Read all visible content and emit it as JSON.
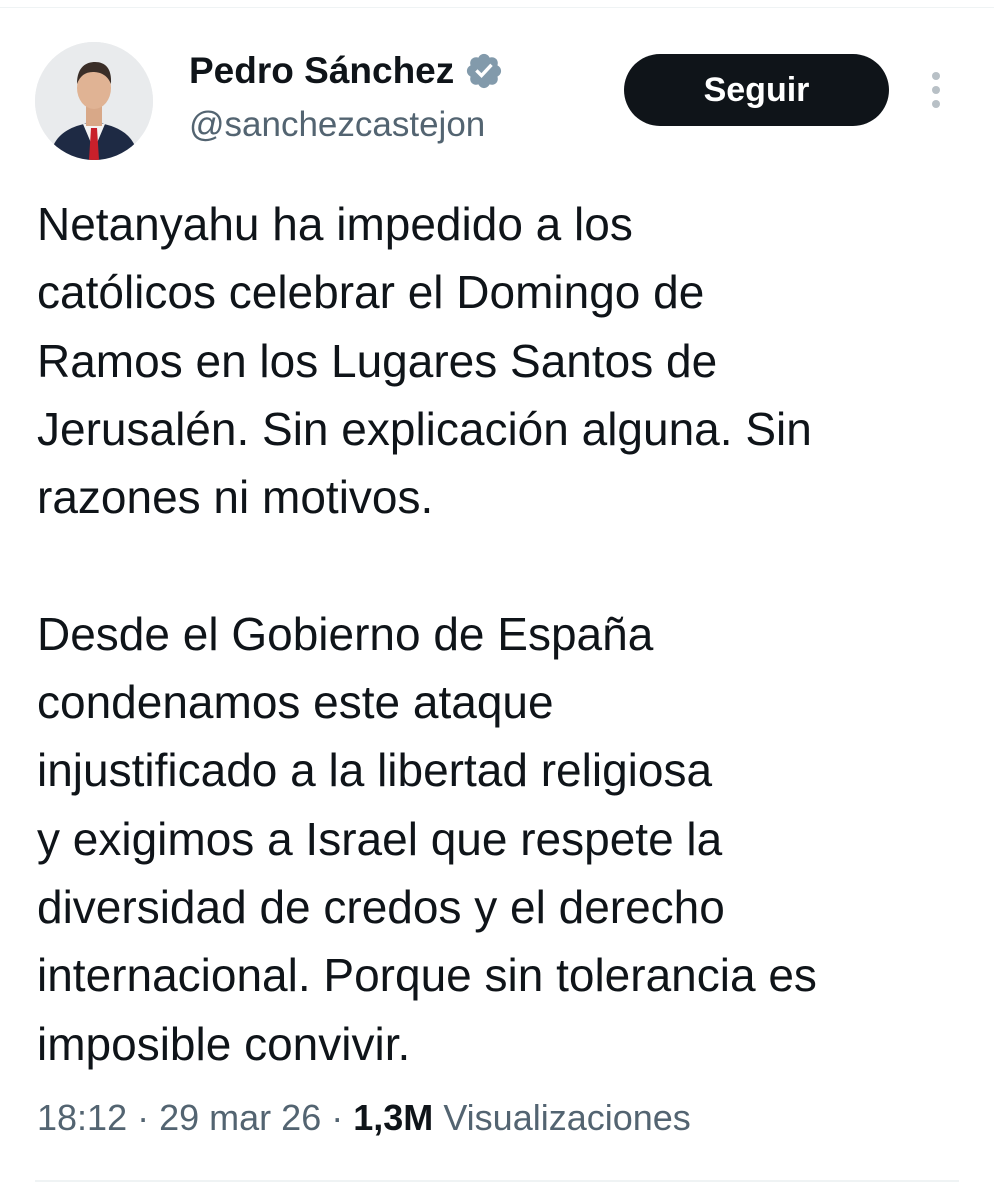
{
  "author": {
    "name": "Pedro Sánchez",
    "handle": "@sanchezcastejon",
    "verified_color": "#829aab"
  },
  "actions": {
    "follow_label": "Seguir"
  },
  "tweet": {
    "paragraph1": [
      "Netanyahu ha impedido a los",
      "católicos celebrar el Domingo de",
      "Ramos en los Lugares Santos de",
      "Jerusalén. Sin explicación alguna. Sin",
      "razones ni motivos."
    ],
    "paragraph2": [
      "Desde el Gobierno de España",
      "condenamos este ataque",
      "injustificado a la libertad religiosa",
      "y exigimos a Israel que respete la",
      "diversidad de credos y el derecho",
      "internacional. Porque sin tolerancia es",
      "imposible convivir."
    ]
  },
  "meta": {
    "time": "18:12",
    "separator": "·",
    "date": "29 mar 26",
    "views_count": "1,3M",
    "views_label": "Visualizaciones"
  },
  "colors": {
    "text": "#0f1419",
    "secondary": "#536471",
    "button_bg": "#0f1419",
    "button_text": "#ffffff",
    "divider": "#eff3f4"
  },
  "icons": {
    "verified": "verified-badge-icon",
    "more": "more-vertical-icon"
  }
}
